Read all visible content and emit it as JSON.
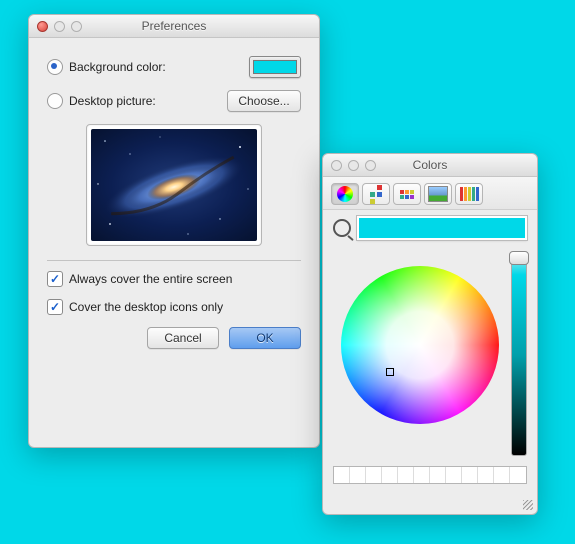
{
  "background_color": "#00d8e8",
  "prefs": {
    "title": "Preferences",
    "bg_color_label": "Background color:",
    "bg_color_value": "#00d8e8",
    "bg_color_selected": true,
    "picture_label": "Desktop picture:",
    "picture_selected": false,
    "choose_label": "Choose...",
    "always_cover_label": "Always cover the entire screen",
    "always_cover_checked": true,
    "cover_icons_label": "Cover the desktop icons only",
    "cover_icons_checked": true,
    "cancel_label": "Cancel",
    "ok_label": "OK"
  },
  "colors": {
    "title": "Colors",
    "current": "#00d8e8",
    "tabs": [
      "wheel",
      "sliders",
      "palettes",
      "image",
      "crayons"
    ],
    "selected_tab": "wheel"
  }
}
